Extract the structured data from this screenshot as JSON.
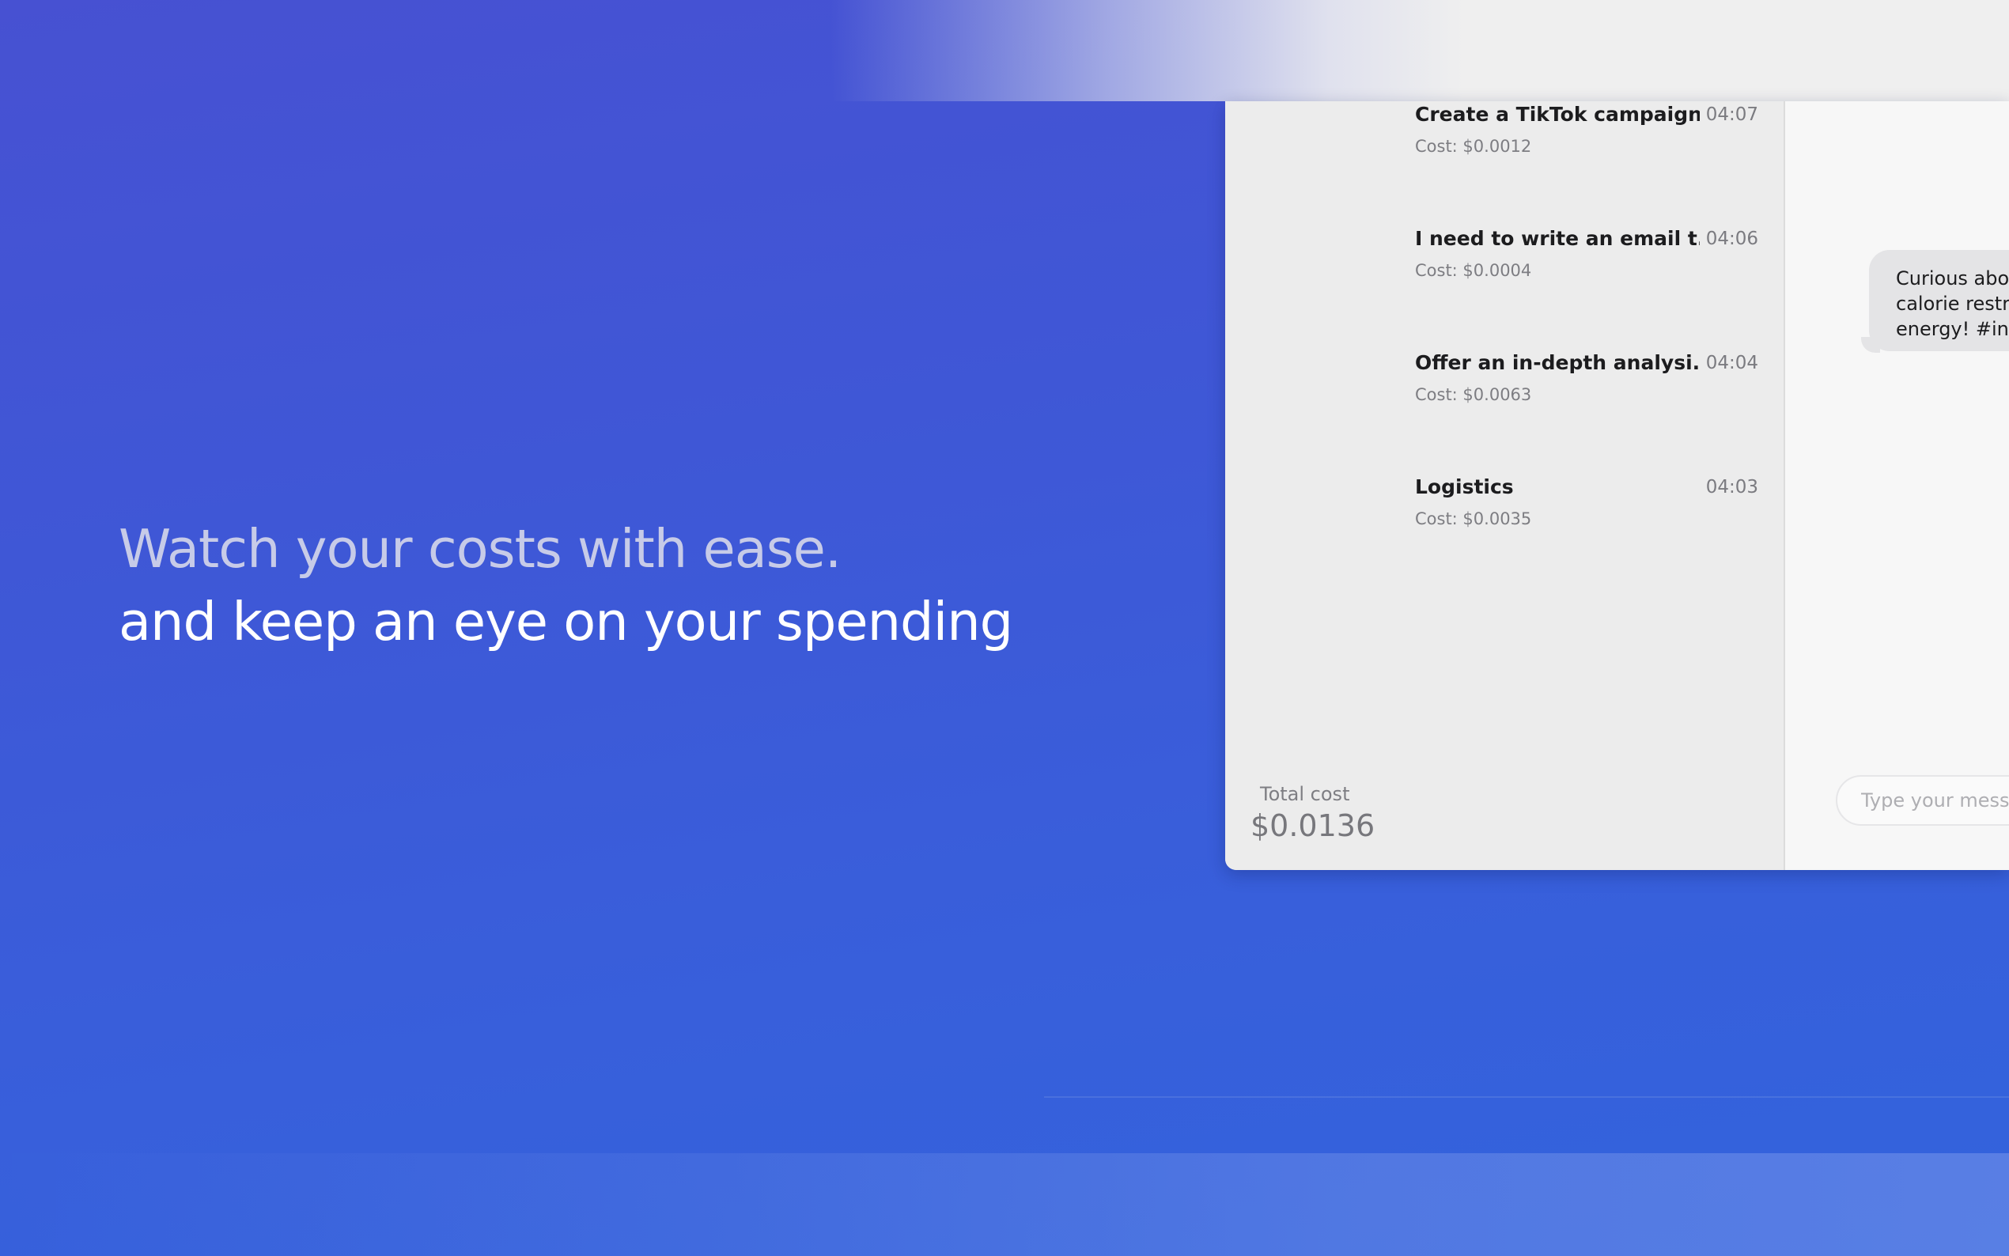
{
  "headline": {
    "line1": "Watch your costs with ease.",
    "line2": "and keep an eye on your spending"
  },
  "sidebar": {
    "chats": [
      {
        "title": "Create a TikTok campaign...",
        "time": "04:07",
        "cost": "Cost: $0.0012"
      },
      {
        "title": "I need to write an email t...",
        "time": "04:06",
        "cost": "Cost: $0.0004"
      },
      {
        "title": "Offer an in-depth analysi...",
        "time": "04:04",
        "cost": "Cost: $0.0063"
      },
      {
        "title": "Logistics",
        "time": "04:03",
        "cost": "Cost: $0.0035"
      }
    ],
    "total_label": "Total cost",
    "total_value": "$0.0136"
  },
  "chat": {
    "message_lines": [
      "Curious abo",
      "calorie restr",
      "energy! #int"
    ],
    "input_placeholder": "Type your mess"
  },
  "colors": {
    "background": "#4751d2",
    "sidebar": "#ececec",
    "bubble": "#e4e4e6"
  }
}
